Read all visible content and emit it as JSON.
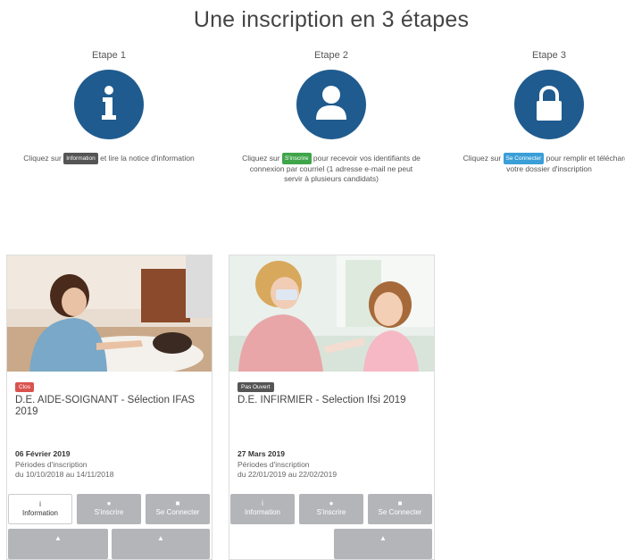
{
  "page_title": "Une inscription en 3 étapes",
  "steps": [
    {
      "label": "Etape 1",
      "desc_before": "Cliquez sur",
      "chip": "Information",
      "desc_after": "et lire la notice d'information",
      "icon": "info-icon"
    },
    {
      "label": "Etape 2",
      "desc_before": "Cliquez sur",
      "chip": "S'inscrire",
      "desc_after": "pour recevoir vos identifiants de connexion par courriel (1 adresse e-mail ne peut servir à plusieurs candidats)",
      "icon": "user-icon"
    },
    {
      "label": "Etape 3",
      "desc_before": "Cliquez sur",
      "chip": "Se Connecter",
      "desc_after": "pour remplir et télécharger votre dossier d'inscription",
      "icon": "lock-icon"
    }
  ],
  "cards": [
    {
      "status": "Clos",
      "status_color": "#d9534f",
      "title": "D.E. AIDE-SOIGNANT - Sélection IFAS 2019",
      "date": "06 Février 2019",
      "period_label": "Périodes d'inscription",
      "period_range": "du 10/10/2018 au 14/11/2018",
      "buttons": [
        "Information",
        "S'inscrire",
        "Se Connecter"
      ]
    },
    {
      "status": "Pas Ouvert",
      "status_color": "#555555",
      "title": "D.E. INFIRMIER - Selection Ifsi 2019",
      "date": "27 Mars 2019",
      "period_label": "Périodes d'inscription",
      "period_range": "du 22/01/2019 au 22/02/2019",
      "buttons": [
        "Information",
        "S'inscrire",
        "Se Connecter"
      ]
    }
  ],
  "colors": {
    "primary": "#1f5b8e",
    "button_gray": "#b3b5b8"
  }
}
